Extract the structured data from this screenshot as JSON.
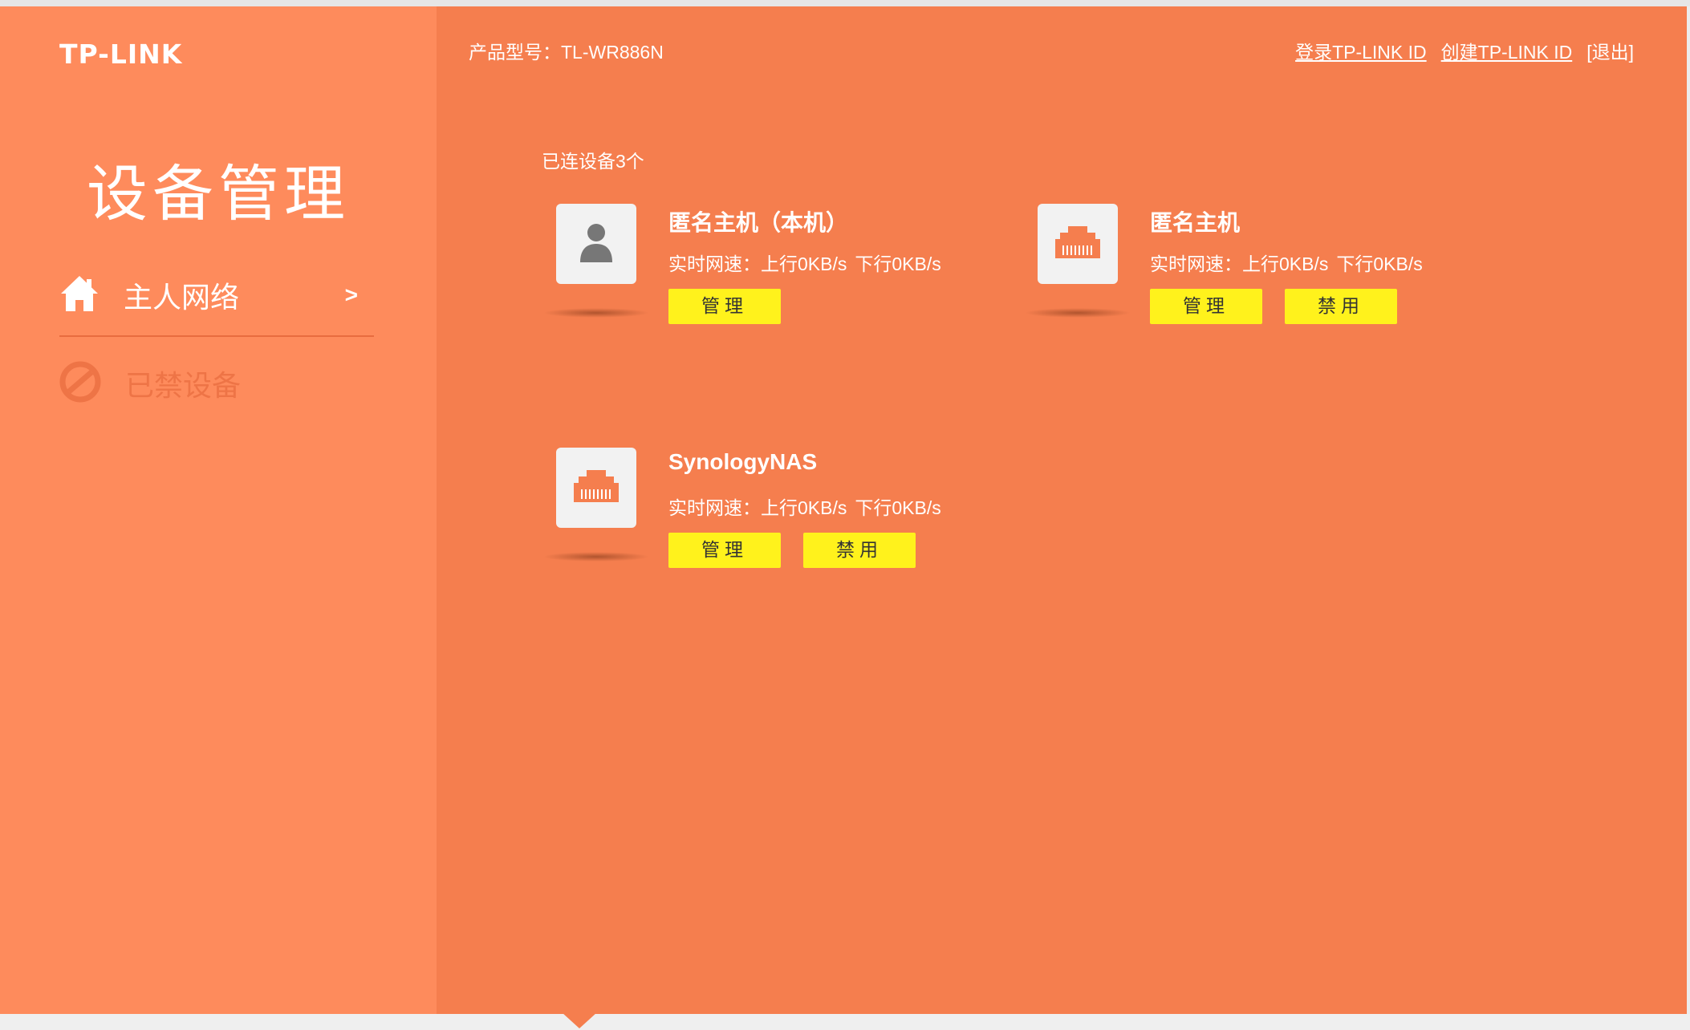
{
  "brand": {
    "logo_text": "TP-LINK"
  },
  "header": {
    "model_label": "产品型号：",
    "model_value": "TL-WR886N",
    "login_link": "登录TP-LINK ID",
    "create_link": "创建TP-LINK ID",
    "exit_link": "[退出]"
  },
  "sidebar": {
    "title": "设备管理",
    "items": [
      {
        "label": "主人网络",
        "arrow": ">",
        "icon": "home-icon"
      },
      {
        "label": "已禁设备",
        "icon": "blocked-icon"
      }
    ]
  },
  "main": {
    "connected_count": "已连设备3个",
    "devices": [
      {
        "name": "匿名主机（本机）",
        "icon": "person-icon",
        "speed_label": "实时网速：",
        "upload": "上行0KB/s",
        "download": "下行0KB/s",
        "manage_label": "管理"
      },
      {
        "name": "匿名主机",
        "icon": "ethernet-port-icon",
        "speed_label": "实时网速：",
        "upload": "上行0KB/s",
        "download": "下行0KB/s",
        "manage_label": "管理",
        "block_label": "禁用"
      },
      {
        "name": "SynologyNAS",
        "icon": "ethernet-port-icon",
        "speed_label": "实时网速：",
        "upload": "上行0KB/s",
        "download": "下行0KB/s",
        "manage_label": "管理",
        "block_label": "禁用"
      }
    ]
  },
  "colors": {
    "sidebar_bg": "#fe8b5c",
    "main_bg": "#f57e4e",
    "button_bg": "#fff21c",
    "icon_tile_bg": "#f2f2f2",
    "port_icon": "#f57e4e",
    "person_icon": "#777777"
  }
}
